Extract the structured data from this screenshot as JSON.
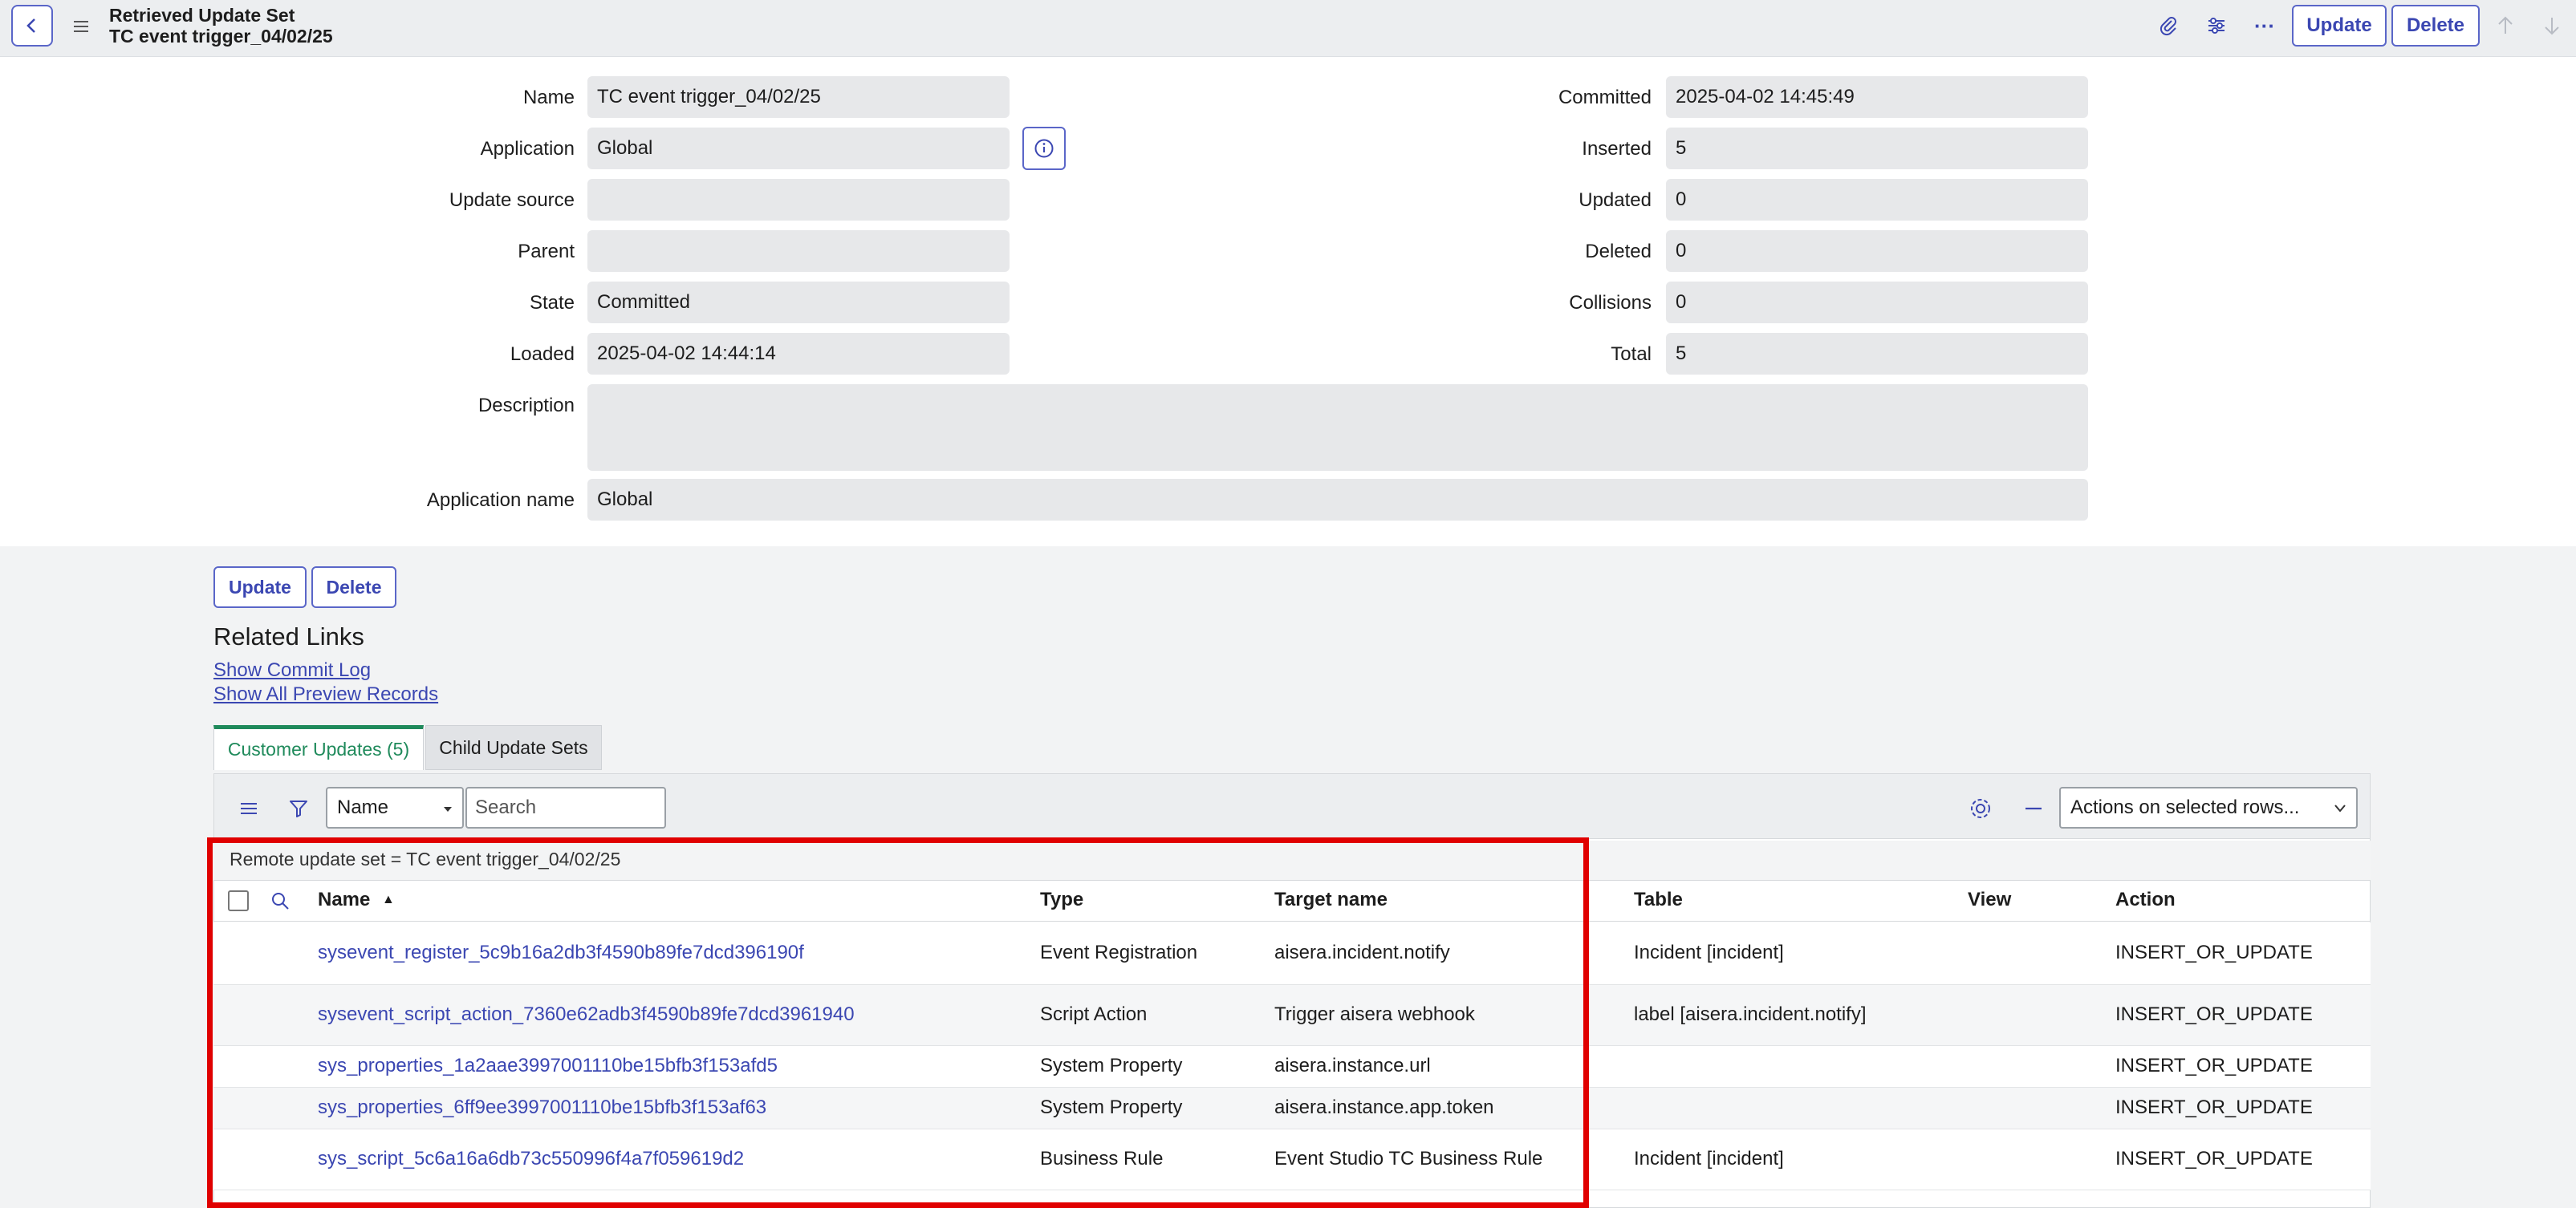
{
  "header": {
    "record_type": "Retrieved Update Set",
    "record_name": "TC event trigger_04/02/25",
    "update_label": "Update",
    "delete_label": "Delete",
    "more_label": "···"
  },
  "form": {
    "name_label": "Name",
    "name_value": "TC event trigger_04/02/25",
    "application_label": "Application",
    "application_value": "Global",
    "update_source_label": "Update source",
    "update_source_value": "",
    "parent_label": "Parent",
    "parent_value": "",
    "state_label": "State",
    "state_value": "Committed",
    "loaded_label": "Loaded",
    "loaded_value": "2025-04-02 14:44:14",
    "description_label": "Description",
    "description_value": "",
    "application_name_label": "Application name",
    "application_name_value": "Global",
    "committed_label": "Committed",
    "committed_value": "2025-04-02 14:45:49",
    "inserted_label": "Inserted",
    "inserted_value": "5",
    "updated_label": "Updated",
    "updated_value": "0",
    "deleted_label": "Deleted",
    "deleted_value": "0",
    "collisions_label": "Collisions",
    "collisions_value": "0",
    "total_label": "Total",
    "total_value": "5"
  },
  "form_buttons": {
    "update_label": "Update",
    "delete_label": "Delete"
  },
  "related_links": {
    "title": "Related Links",
    "show_commit_log": "Show Commit Log",
    "show_all_preview_records": "Show All Preview Records"
  },
  "tabs": [
    {
      "label": "Customer Updates (5)",
      "active": true
    },
    {
      "label": "Child Update Sets",
      "active": false
    }
  ],
  "list": {
    "search_field_select": "Name",
    "search_placeholder": "Search",
    "actions_select": "Actions on selected rows...",
    "breadcrumb": "Remote update set = TC event trigger_04/02/25",
    "columns": [
      "Name",
      "Type",
      "Target name",
      "Table",
      "View",
      "Action"
    ],
    "sort_indicator": "▲",
    "rows": [
      {
        "name": "sysevent_register_5c9b16a2db3f4590b89fe7dcd396190f",
        "type": "Event Registration",
        "target_name": "aisera.incident.notify",
        "table": "Incident [incident]",
        "view": "",
        "action": "INSERT_OR_UPDATE"
      },
      {
        "name": "sysevent_script_action_7360e62adb3f4590b89fe7dcd3961940",
        "type": "Script Action",
        "target_name": "Trigger aisera webhook",
        "table": "label [aisera.incident.notify]",
        "view": "",
        "action": "INSERT_OR_UPDATE"
      },
      {
        "name": "sys_properties_1a2aae3997001110be15bfb3f153afd5",
        "type": "System Property",
        "target_name": "aisera.instance.url",
        "table": "",
        "view": "",
        "action": "INSERT_OR_UPDATE"
      },
      {
        "name": "sys_properties_6ff9ee3997001110be15bfb3f153af63",
        "type": "System Property",
        "target_name": "aisera.instance.app.token",
        "table": "",
        "view": "",
        "action": "INSERT_OR_UPDATE"
      },
      {
        "name": "sys_script_5c6a16a6db73c550996f4a7f059619d2",
        "type": "Business Rule",
        "target_name": "Event Studio TC Business Rule",
        "table": "Incident [incident]",
        "view": "",
        "action": "INSERT_OR_UPDATE"
      }
    ]
  },
  "colors": {
    "accent": "#3b47b2",
    "tab_active": "#1f8a5b",
    "highlight": "#e00000"
  },
  "icons": [
    "back-icon",
    "hamburger-icon",
    "paperclip-icon",
    "settings-sliders-icon",
    "more-icon",
    "arrow-up-icon",
    "arrow-down-icon",
    "info-icon",
    "filter-icon",
    "search-icon",
    "gear-icon",
    "collapse-icon",
    "chevron-down-icon",
    "sort-ascending-icon"
  ]
}
